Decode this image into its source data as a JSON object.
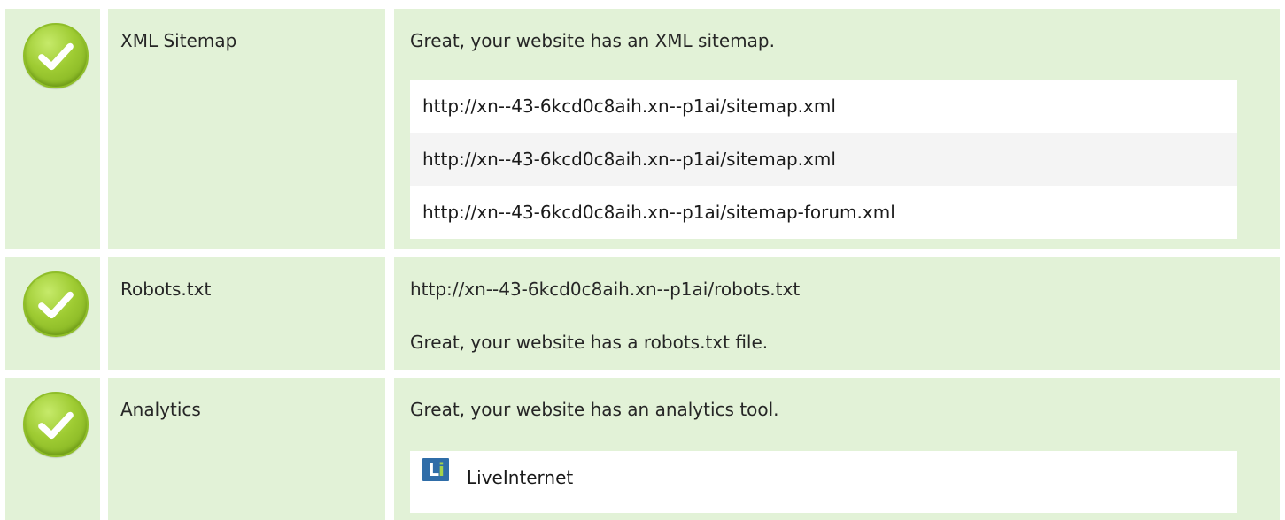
{
  "rows": [
    {
      "status": "pass",
      "label": "XML Sitemap",
      "message": "Great, your website has an XML sitemap.",
      "items": [
        "http://xn--43-6kcd0c8aih.xn--p1ai/sitemap.xml",
        "http://xn--43-6kcd0c8aih.xn--p1ai/sitemap.xml",
        "http://xn--43-6kcd0c8aih.xn--p1ai/sitemap-forum.xml"
      ]
    },
    {
      "status": "pass",
      "label": "Robots.txt",
      "url": "http://xn--43-6kcd0c8aih.xn--p1ai/robots.txt",
      "message": "Great, your website has a robots.txt file."
    },
    {
      "status": "pass",
      "label": "Analytics",
      "message": "Great, your website has an analytics tool.",
      "tool": {
        "icon": "liveinternet-logo-icon",
        "name": "LiveInternet"
      }
    }
  ],
  "colors": {
    "row_background": "#e2f2d7",
    "check_green": "#9fcc33",
    "list_background": "#ffffff",
    "list_alt_background": "#f4f4f4"
  }
}
